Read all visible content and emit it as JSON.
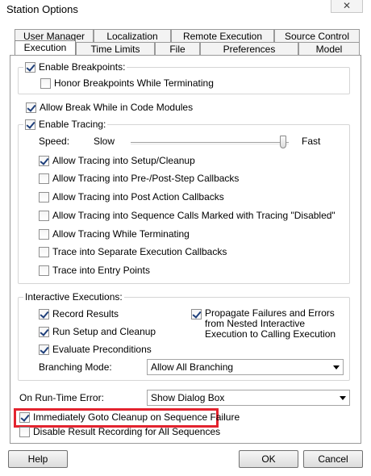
{
  "window": {
    "title": "Station Options",
    "close_glyph": "✕"
  },
  "tabs_back": [
    "User Manager",
    "Localization",
    "Remote Execution",
    "Source Control"
  ],
  "tabs_front": [
    "Execution",
    "Time Limits",
    "File",
    "Preferences",
    "Model"
  ],
  "active_tab": "Execution",
  "breakpoints": {
    "enable_label": "Enable Breakpoints:",
    "enable_checked": true,
    "honor_label": "Honor Breakpoints While Terminating",
    "honor_checked": false
  },
  "allow_break": {
    "label": "Allow Break While in Code Modules",
    "checked": true
  },
  "tracing": {
    "enable_label": "Enable Tracing:",
    "enable_checked": true,
    "speed_label": "Speed:",
    "slow_label": "Slow",
    "fast_label": "Fast",
    "speed_value": 0.97,
    "options": [
      {
        "label": "Allow Tracing into Setup/Cleanup",
        "checked": true
      },
      {
        "label": "Allow Tracing into Pre-/Post-Step Callbacks",
        "checked": false
      },
      {
        "label": "Allow Tracing into Post Action Callbacks",
        "checked": false
      },
      {
        "label": "Allow Tracing into Sequence Calls Marked with Tracing \"Disabled\"",
        "checked": false
      },
      {
        "label": "Allow Tracing While Terminating",
        "checked": false
      },
      {
        "label": "Trace into Separate Execution Callbacks",
        "checked": false
      },
      {
        "label": "Trace into Entry Points",
        "checked": false
      }
    ]
  },
  "interactive": {
    "legend": "Interactive Executions:",
    "record_results": {
      "label": "Record Results",
      "checked": true
    },
    "run_setup": {
      "label": "Run Setup and Cleanup",
      "checked": true
    },
    "evaluate": {
      "label": "Evaluate Preconditions",
      "checked": true
    },
    "propagate": {
      "label": "Propagate Failures and Errors from Nested Interactive Execution to Calling Execution",
      "checked": true
    },
    "branching_label": "Branching Mode:",
    "branching_value": "Allow All Branching"
  },
  "runtime_error": {
    "label": "On Run-Time Error:",
    "value": "Show Dialog Box"
  },
  "goto_cleanup": {
    "label": "Immediately Goto Cleanup on Sequence Failure",
    "checked": true
  },
  "disable_recording": {
    "label": "Disable Result Recording for All Sequences",
    "checked": false
  },
  "buttons": {
    "help": "Help",
    "ok": "OK",
    "cancel": "Cancel"
  },
  "colors": {
    "highlight": "#e3232e",
    "check": "#1e3f7a"
  }
}
